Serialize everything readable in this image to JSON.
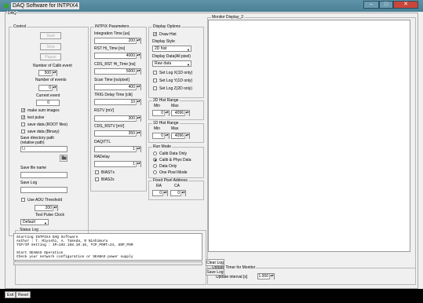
{
  "window": {
    "title": "DAQ Software for INTPIX4",
    "min": "–",
    "max": "□",
    "close": "✕"
  },
  "daq_label": "DAQ",
  "control": {
    "legend": "Control",
    "start": "Start",
    "stop": "Stop",
    "pause": "Pause",
    "ncal_label": "Number of Calib event",
    "ncal": "500",
    "nev_label": "Number of events",
    "nev": "0",
    "cur_label": "Current event",
    "cur": "0",
    "make_sum": "make sum images",
    "test_pulse": "test pulse",
    "save_root": "save data (ROOT files)",
    "save_binary": "save data (Binary)",
    "save_dir_label": "Save directory path (relative path)",
    "save_dir": "\\.\\",
    "save_file_label": "Save file name",
    "save_file": "",
    "save_log_label": "Save Log",
    "save_log": "",
    "use_adu": "Use ADU Threshold",
    "adu": "200",
    "tpc_label": "Test Pulse Clock",
    "tpc": "Default"
  },
  "intpix": {
    "legend": "INTPIX Parameters",
    "it_label": "Integration Time [us]",
    "it": "200",
    "rst_label": "RST Hi_Time [ns]",
    "rst": "4000",
    "cds_label": "CDS_RST Hi_Time [ns]",
    "cds": "5000",
    "scan_label": "Scan Time [ns/pixel]",
    "scan": "400",
    "trig_label": "TRIG Delay Time [clk]",
    "trig": "10",
    "rstv_label": "RSTV [mV]",
    "rstv": "300",
    "cdsv_label": "CDS_RSTV [mV]",
    "cdsv": "350",
    "daq_label": "DAQ/TTL",
    "daq": "1",
    "radelay_label": "RADelay",
    "radelay": "1",
    "biastx": "BIASTx",
    "bias2x": "BIAS2x"
  },
  "display": {
    "legend": "Display Options",
    "draw_hist": "Draw Hist",
    "style_label": "Display Style",
    "style": "2D hist",
    "data_label": "Display Data(All pixel)",
    "data": "Raw data",
    "setx": "Set Log X(1D only)",
    "sety": "Set Log Y(1D only)",
    "setz": "Set Log Z(2D only)"
  },
  "range2d": {
    "legend": "2D Hist Range",
    "min_label": "Min",
    "max_label": "Max",
    "min": "0",
    "max": "4096"
  },
  "range1d": {
    "legend": "1D Hist Range",
    "min_label": "Min",
    "max_label": "Max",
    "min": "0",
    "max": "4096"
  },
  "runmode": {
    "legend": "Run Mode",
    "opt1": "Calib Data Only",
    "opt2": "Calib & Phys Data",
    "opt3": "Data Only",
    "opt4": "One Pixel Mode"
  },
  "fixed": {
    "legend": "Fixed Pixel Address",
    "ra_label": "RA",
    "ca_label": "CA",
    "ra": "0",
    "ca": "0"
  },
  "monitor": {
    "legend": "Monitor Display_2"
  },
  "status": {
    "legend": "Status Log",
    "text": "Starting INTPIX4 DAQ Software\nAuthor : T. Miyoshi, A. Takeda, R Nishimura\nTCP/IP Setting : IP=192.168.10.16, TCP_PORT=24, UDP_POR\n\nStart SEABAS Operation\nCheck your network configuration or SEABAS power supply",
    "clear": "Clear Log",
    "save": "Save Log"
  },
  "timer": {
    "legend": "Update Timer for Monitor",
    "label": "Update interval [s]",
    "value": "1.000"
  },
  "bottom": {
    "exit": "Exit",
    "reset": "Reset"
  }
}
